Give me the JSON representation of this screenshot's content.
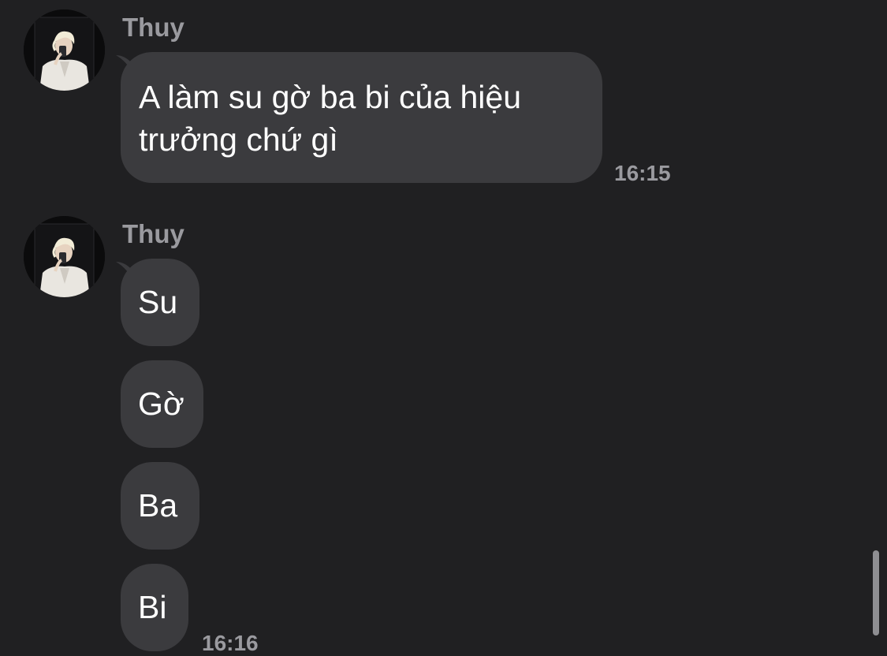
{
  "colors": {
    "background": "#202022",
    "bubble": "#3b3b3e",
    "secondary_text": "#9a9a9f",
    "text": "#ffffff"
  },
  "groups": [
    {
      "sender": "Thuy",
      "avatar": "avatar-icon",
      "messages": [
        {
          "text": "A làm su gờ ba bi của hiệu trưởng chứ gì"
        }
      ],
      "time": "16:15"
    },
    {
      "sender": "Thuy",
      "avatar": "avatar-icon",
      "messages": [
        {
          "text": "Su"
        },
        {
          "text": "Gờ"
        },
        {
          "text": "Ba"
        },
        {
          "text": "Bi"
        }
      ],
      "time": "16:16"
    }
  ]
}
